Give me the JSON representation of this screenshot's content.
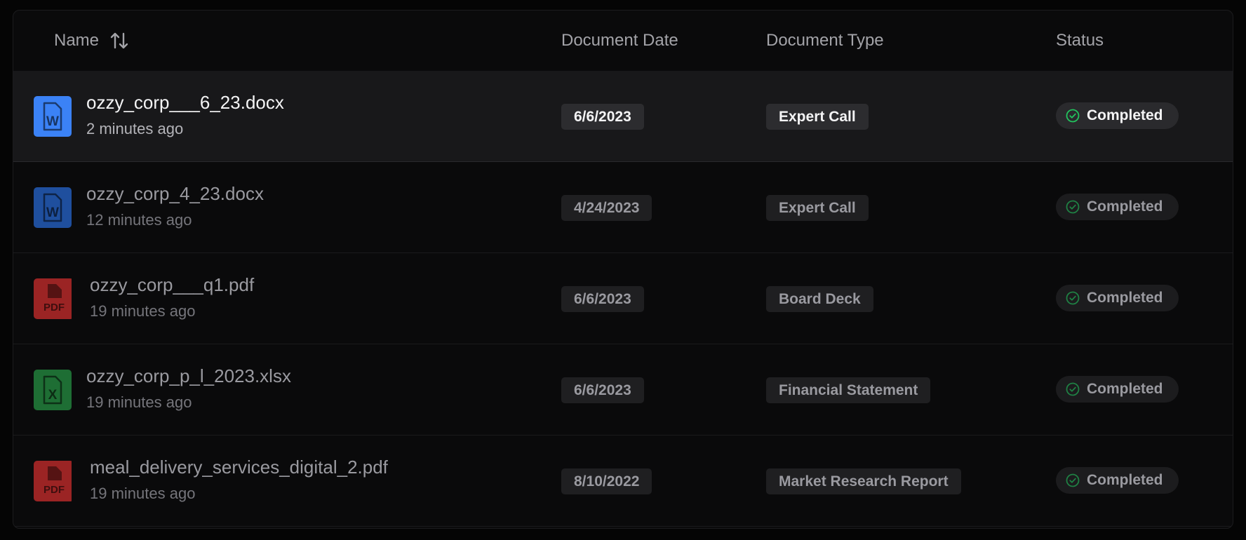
{
  "table": {
    "columns": {
      "name": "Name",
      "document_date": "Document Date",
      "document_type": "Document Type",
      "status": "Status"
    },
    "rows": [
      {
        "file_name": "ozzy_corp___6_23.docx",
        "uploaded": "2 minutes ago",
        "file_type": "word",
        "icon_label": "W",
        "document_date": "6/6/2023",
        "document_type": "Expert Call",
        "status": "Completed"
      },
      {
        "file_name": "ozzy_corp_4_23.docx",
        "uploaded": "12 minutes ago",
        "file_type": "word",
        "icon_label": "W",
        "document_date": "4/24/2023",
        "document_type": "Expert Call",
        "status": "Completed"
      },
      {
        "file_name": "ozzy_corp___q1.pdf",
        "uploaded": "19 minutes ago",
        "file_type": "pdf",
        "icon_label": "PDF",
        "document_date": "6/6/2023",
        "document_type": "Board Deck",
        "status": "Completed"
      },
      {
        "file_name": "ozzy_corp_p_l_2023.xlsx",
        "uploaded": "19 minutes ago",
        "file_type": "excel",
        "icon_label": "X",
        "document_date": "6/6/2023",
        "document_type": "Financial Statement",
        "status": "Completed"
      },
      {
        "file_name": "meal_delivery_services_digital_2.pdf",
        "uploaded": "19 minutes ago",
        "file_type": "pdf",
        "icon_label": "PDF",
        "document_date": "8/10/2022",
        "document_type": "Market Research Report",
        "status": "Completed"
      }
    ]
  },
  "icons": {
    "sort": "sort-arrows-icon",
    "word": "word-document-icon",
    "pdf": "pdf-document-icon",
    "excel": "excel-document-icon",
    "status": "check-circle-icon"
  },
  "colors": {
    "word_active": "#3b82f6",
    "word": "#1f4f9e",
    "pdf": "#9b2424",
    "excel": "#1e6e34",
    "status_check": "#22c55e"
  }
}
